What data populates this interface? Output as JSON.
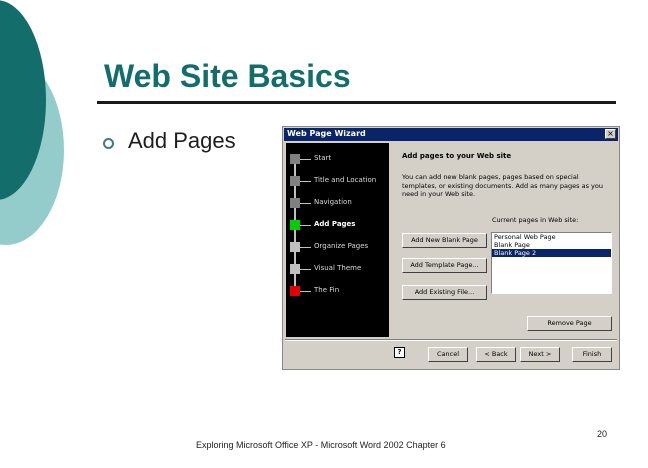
{
  "slide": {
    "title": "Web Site Basics",
    "bullet": "Add Pages",
    "footer": "Exploring Microsoft Office XP - Microsoft Word 2002 Chapter 6",
    "page_number": "20"
  },
  "colors": {
    "title": "#126d6b",
    "deco_dark": "#126d6b",
    "deco_light": "#94cccc",
    "dialog_bg": "#d4d0c8",
    "titlebar": "#0a246a",
    "step_active": "#00d000",
    "step_done": "#808080",
    "step_pending": "#c0c0c0",
    "step_finish": "#e00000"
  },
  "dialog": {
    "title": "Web Page Wizard",
    "close": "×",
    "steps": [
      {
        "label": "Start",
        "state": "done"
      },
      {
        "label": "Title and Location",
        "state": "done"
      },
      {
        "label": "Navigation",
        "state": "done"
      },
      {
        "label": "Add Pages",
        "state": "active"
      },
      {
        "label": "Organize Pages",
        "state": "pending"
      },
      {
        "label": "Visual Theme",
        "state": "pending"
      },
      {
        "label": "The Fin",
        "state": "finish"
      }
    ],
    "heading": "Add pages to your Web site",
    "description": "You can add new blank pages, pages based on special templates, or existing documents. Add as many pages as you need in your Web site.",
    "list_label": "Current pages in Web site:",
    "pages": [
      {
        "label": "Personal Web Page",
        "selected": false
      },
      {
        "label": "Blank Page",
        "selected": false
      },
      {
        "label": "Blank Page 2",
        "selected": true
      }
    ],
    "buttons": {
      "add_blank": "Add New Blank Page",
      "add_template": "Add Template Page...",
      "add_existing": "Add Existing File...",
      "remove": "Remove Page",
      "cancel": "Cancel",
      "back": "< Back",
      "next": "Next >",
      "finish": "Finish"
    },
    "help": "?"
  }
}
